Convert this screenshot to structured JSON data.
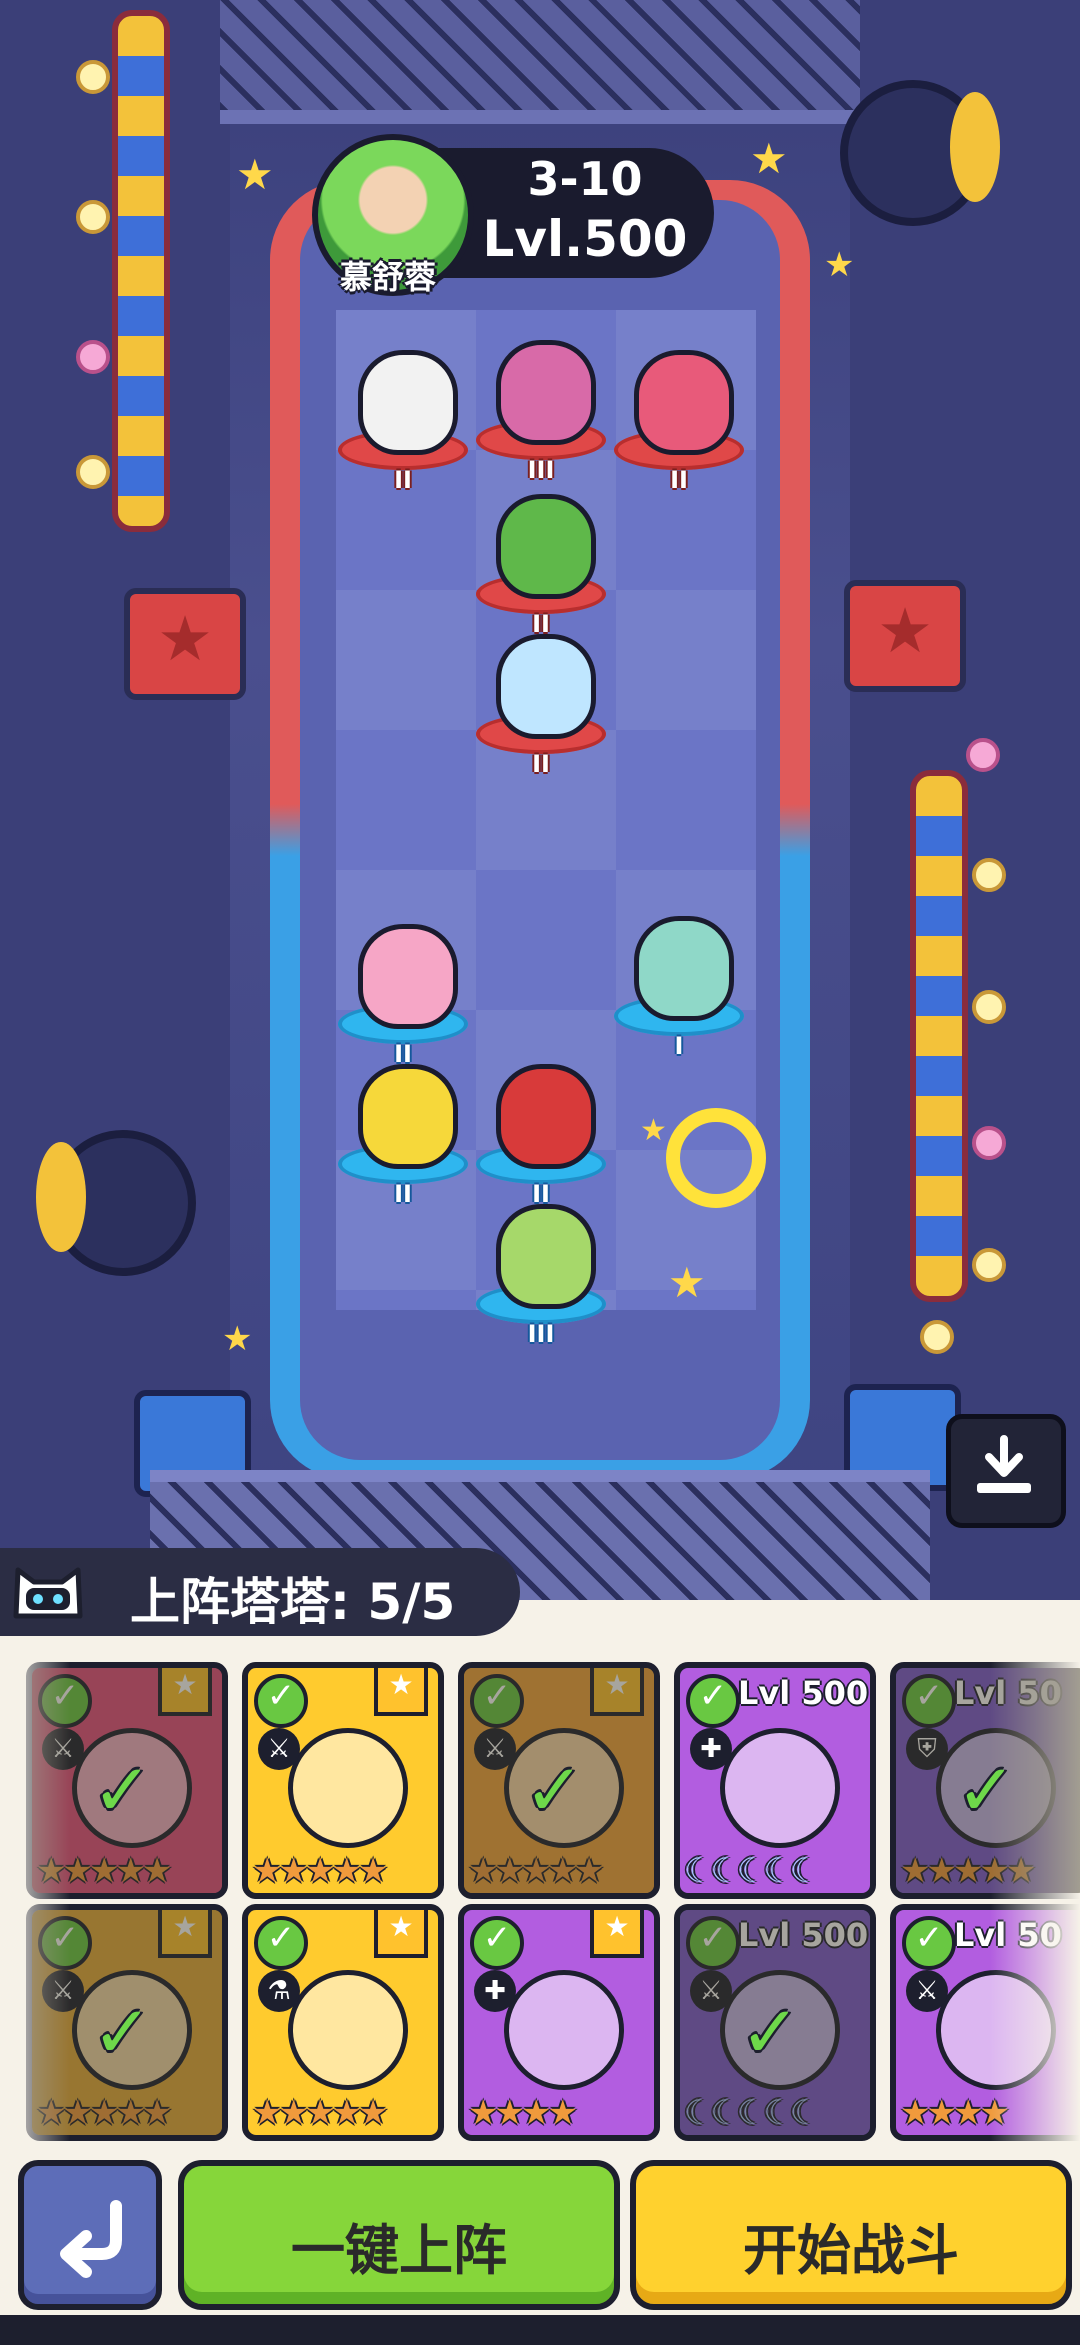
{
  "opponent": {
    "name": "慕舒蓉",
    "stage": "3-10",
    "level": "Lvl.500"
  },
  "board": {
    "enemy_units": [
      {
        "rank": "II",
        "color": "#f2f2f2"
      },
      {
        "rank": "III",
        "color": "#d86aa8"
      },
      {
        "rank": "II",
        "color": "#e85a7a"
      },
      {
        "rank": "II",
        "color": "#5fb84a"
      },
      {
        "rank": "II",
        "color": "#bfe6ff"
      }
    ],
    "ally_units": [
      {
        "rank": "II",
        "color": "#f6a6c6"
      },
      {
        "rank": "I",
        "color": "#8fd8c8"
      },
      {
        "rank": "II",
        "color": "#f6d83a"
      },
      {
        "rank": "II",
        "color": "#d83a3a"
      },
      {
        "rank": "III",
        "color": "#a6d86a"
      }
    ]
  },
  "roster": {
    "label": "上阵塔塔: 5/5"
  },
  "cards_row1": [
    {
      "bg": "#e44f7e",
      "check": "✓",
      "stars": "★★★★★",
      "bookmark": true,
      "dim": true,
      "type": "⚔",
      "level": ""
    },
    {
      "bg": "#ffcb2e",
      "check": "",
      "stars": "★★★★★",
      "bookmark": true,
      "dim": false,
      "type": "⚔",
      "level": ""
    },
    {
      "bg": "#f0a33b",
      "check": "✓",
      "stars": "★★★★★",
      "bookmark": true,
      "dim": true,
      "type": "⚔",
      "level": ""
    },
    {
      "bg": "#b25de0",
      "check": "",
      "stars": "☾☾☾☾☾",
      "bookmark": false,
      "dim": false,
      "type": "✚",
      "level": "Lvl 500"
    },
    {
      "bg": "#7c5ad0",
      "check": "✓",
      "stars": "★★★★★",
      "bookmark": false,
      "dim": true,
      "type": "⛨",
      "level": "Lvl 50"
    }
  ],
  "cards_row2": [
    {
      "bg": "#e4a93a",
      "check": "✓",
      "stars": "★★★★★",
      "bookmark": true,
      "dim": true,
      "type": "⚔",
      "level": ""
    },
    {
      "bg": "#ffcb2e",
      "check": "",
      "stars": "★★★★★",
      "bookmark": true,
      "dim": false,
      "type": "⚗",
      "level": ""
    },
    {
      "bg": "#b25de0",
      "check": "",
      "stars": "★★★★",
      "bookmark": true,
      "dim": false,
      "type": "✚",
      "level": ""
    },
    {
      "bg": "#7c5ad0",
      "check": "✓",
      "stars": "☾☾☾☾☾",
      "bookmark": false,
      "dim": true,
      "type": "⚔",
      "level": "Lvl 500"
    },
    {
      "bg": "#b25de0",
      "check": "",
      "stars": "★★★★",
      "bookmark": false,
      "dim": false,
      "type": "⚔",
      "level": "Lvl 50"
    }
  ],
  "buttons": {
    "auto_deploy": "一键上阵",
    "start_battle": "开始战斗"
  },
  "colors": {
    "enemy_base": "#e04848",
    "ally_base": "#2fb6ef",
    "auto_btn": "#86d63a",
    "start_btn": "#ffd12e"
  }
}
